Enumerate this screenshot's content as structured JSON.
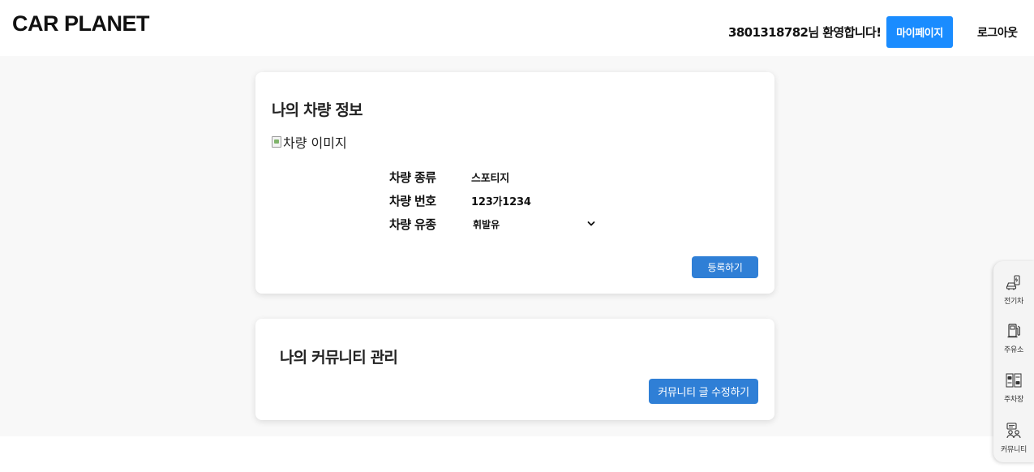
{
  "header": {
    "logo": "CAR PLANET",
    "welcome": "3801318782님 환영합니다!",
    "mypage_label": "마이페이지",
    "logout_label": "로그아웃"
  },
  "car_card": {
    "title": "나의 차량 정보",
    "image_alt": "차량 이미지",
    "rows": [
      {
        "label": "차량 종류",
        "value": "스포티지"
      },
      {
        "label": "차량 번호",
        "value": "123가1234"
      },
      {
        "label": "차량 유종",
        "value": "휘발유"
      }
    ],
    "register_label": "등록하기"
  },
  "community_card": {
    "title": "나의 커뮤니티 관리",
    "edit_label": "커뮤니티 글 수정하기"
  },
  "floating_menu": [
    {
      "label": "전기차",
      "icon": "ev-charger-icon"
    },
    {
      "label": "주유소",
      "icon": "gas-station-icon"
    },
    {
      "label": "주차장",
      "icon": "parking-icon"
    },
    {
      "label": "커뮤니티",
      "icon": "community-icon"
    }
  ],
  "colors": {
    "primary_button": "#1a8cff",
    "action_button": "#2f7fd6",
    "page_background": "#f8f8f8"
  }
}
